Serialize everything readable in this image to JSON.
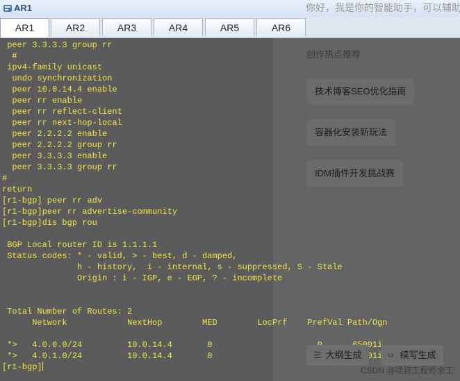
{
  "window": {
    "title": "AR1"
  },
  "assistant_greeting": "你好，我是你的智能助手，可以辅助",
  "tabs": [
    {
      "label": "AR1",
      "active": true
    },
    {
      "label": "AR2",
      "active": false
    },
    {
      "label": "AR3",
      "active": false
    },
    {
      "label": "AR4",
      "active": false
    },
    {
      "label": "AR5",
      "active": false
    },
    {
      "label": "AR6",
      "active": false
    }
  ],
  "terminal": {
    "lines": [
      " peer 3.3.3.3 group rr",
      "  #",
      " ipv4-family unicast",
      "  undo synchronization",
      "  peer 10.0.14.4 enable",
      "  peer rr enable",
      "  peer rr reflect-client",
      "  peer rr next-hop-local",
      "  peer 2.2.2.2 enable",
      "  peer 2.2.2.2 group rr",
      "  peer 3.3.3.3 enable",
      "  peer 3.3.3.3 group rr",
      "#",
      "return",
      "[r1-bgp] peer rr adv",
      "[r1-bgp]peer rr advertise-community",
      "[r1-bgp]dis bgp rou",
      "",
      " BGP Local router ID is 1.1.1.1",
      " Status codes: * - valid, > - best, d - damped,",
      "               h - history,  i - internal, s - suppressed, S - Stale",
      "               Origin : i - IGP, e - EGP, ? - incomplete",
      "",
      "",
      " Total Number of Routes: 2",
      "      Network            NextHop        MED        LocPrf    PrefVal Path/Ogn",
      "",
      " *>   4.0.0.0/24         10.0.14.4       0                     0      65001i",
      " *>   4.0.1.0/24         10.0.14.4       0                     0      65001i"
    ],
    "prompt": "[r1-bgp]",
    "text_color": "#f0e64a",
    "background": "#5b5b5b"
  },
  "side_panel": {
    "heading": "创作热点推荐",
    "chips": [
      "技术博客SEO优化指南",
      "容器化安装新玩法",
      "IDM插件开发挑战赛"
    ],
    "bottom_buttons": [
      {
        "label": "大纲生成",
        "icon": "list-icon"
      },
      {
        "label": "续写生成",
        "icon": "expand-icon"
      }
    ],
    "watermark": "CSDN @项目工程师余工"
  }
}
